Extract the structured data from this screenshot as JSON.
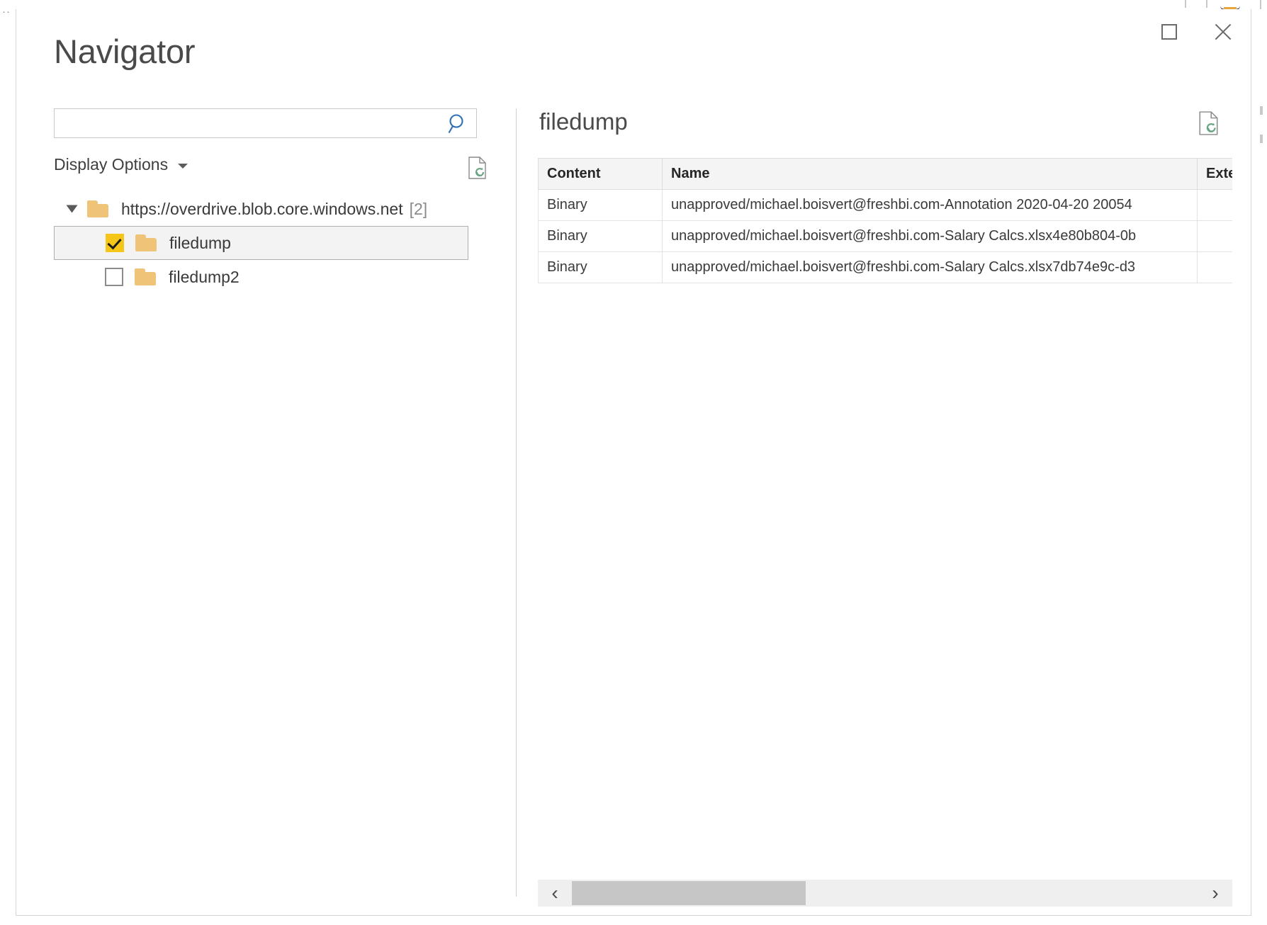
{
  "window": {
    "title": "Navigator",
    "maximize_label": "Maximize",
    "close_label": "Close",
    "maximize_icon": "maximize-icon",
    "close_icon": "close-icon"
  },
  "search": {
    "value": "",
    "placeholder": "",
    "icon": "search-icon"
  },
  "display_options": {
    "label": "Display Options",
    "caret_icon": "chevron-down-icon",
    "refresh_icon": "document-refresh-icon"
  },
  "tree": {
    "root": {
      "label": "https://overdrive.blob.core.windows.net",
      "count": "[2]",
      "expanded": true,
      "expander_icon": "triangle-expanded-icon",
      "folder_icon": "folder-icon"
    },
    "children": [
      {
        "label": "filedump",
        "checked": true,
        "selected": true,
        "checkbox_icon": "checkbox-checked-icon",
        "folder_icon": "folder-icon"
      },
      {
        "label": "filedump2",
        "checked": false,
        "selected": false,
        "checkbox_icon": "checkbox-unchecked-icon",
        "folder_icon": "folder-icon"
      }
    ]
  },
  "preview": {
    "title": "filedump",
    "refresh_icon": "document-refresh-icon",
    "columns": [
      "Content",
      "Name",
      "Extension"
    ],
    "rows": [
      {
        "content": "Binary",
        "name": "unapproved/michael.boisvert@freshbi.com-Annotation 2020-04-20 20054",
        "extension": ""
      },
      {
        "content": "Binary",
        "name": "unapproved/michael.boisvert@freshbi.com-Salary Calcs.xlsx4e80b804-0b",
        "extension": ""
      },
      {
        "content": "Binary",
        "name": "unapproved/michael.boisvert@freshbi.com-Salary Calcs.xlsx7db74e9c-d3",
        "extension": ""
      }
    ]
  },
  "scrollbar": {
    "left_arrow": "‹",
    "right_arrow": "›",
    "left_arrow_icon": "chevron-left-icon",
    "right_arrow_icon": "chevron-right-icon"
  },
  "colors": {
    "accent_yellow": "#f5c518",
    "folder": "#efc479",
    "search_icon_blue": "#2f6fb5",
    "refresh_green": "#6aa583",
    "selection_bg": "#f3f3f3"
  }
}
